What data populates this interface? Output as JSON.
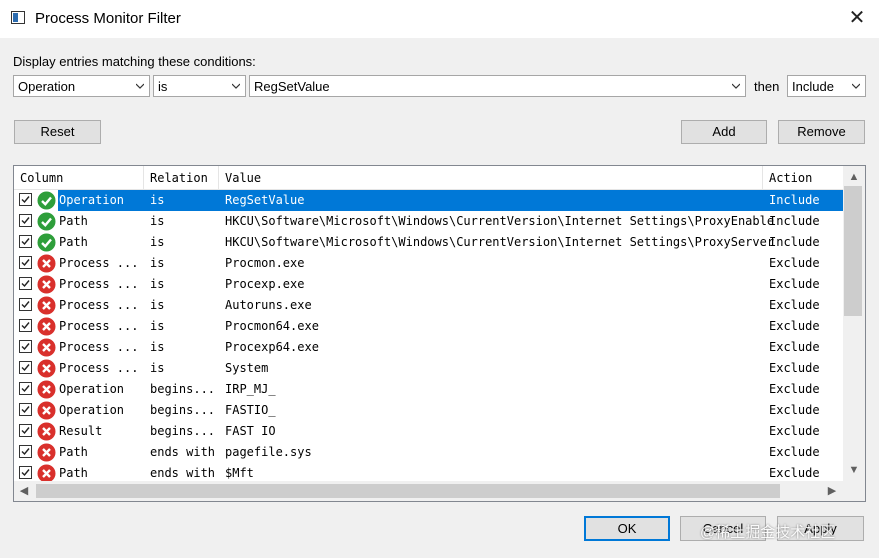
{
  "window": {
    "title": "Process Monitor Filter",
    "close_label": "✕"
  },
  "prompt": "Display entries matching these conditions:",
  "filter": {
    "column": "Operation",
    "relation": "is",
    "value": "RegSetValue",
    "then_label": "then",
    "action": "Include"
  },
  "buttons": {
    "reset": "Reset",
    "add": "Add",
    "remove": "Remove",
    "ok": "OK",
    "cancel": "Cancel",
    "apply": "Apply"
  },
  "table": {
    "headers": [
      "Column",
      "Relation",
      "Value",
      "Action"
    ],
    "rows": [
      {
        "column": "Operation",
        "relation": "is",
        "value": "RegSetValue",
        "action": "Include",
        "status": "include",
        "selected": true
      },
      {
        "column": "Path",
        "relation": "is",
        "value": "HKCU\\Software\\Microsoft\\Windows\\CurrentVersion\\Internet Settings\\ProxyEnable",
        "action": "Include",
        "status": "include"
      },
      {
        "column": "Path",
        "relation": "is",
        "value": "HKCU\\Software\\Microsoft\\Windows\\CurrentVersion\\Internet Settings\\ProxyServer",
        "action": "Include",
        "status": "include"
      },
      {
        "column": "Process ...",
        "relation": "is",
        "value": "Procmon.exe",
        "action": "Exclude",
        "status": "exclude"
      },
      {
        "column": "Process ...",
        "relation": "is",
        "value": "Procexp.exe",
        "action": "Exclude",
        "status": "exclude"
      },
      {
        "column": "Process ...",
        "relation": "is",
        "value": "Autoruns.exe",
        "action": "Exclude",
        "status": "exclude"
      },
      {
        "column": "Process ...",
        "relation": "is",
        "value": "Procmon64.exe",
        "action": "Exclude",
        "status": "exclude"
      },
      {
        "column": "Process ...",
        "relation": "is",
        "value": "Procexp64.exe",
        "action": "Exclude",
        "status": "exclude"
      },
      {
        "column": "Process ...",
        "relation": "is",
        "value": "System",
        "action": "Exclude",
        "status": "exclude"
      },
      {
        "column": "Operation",
        "relation": "begins...",
        "value": "IRP_MJ_",
        "action": "Exclude",
        "status": "exclude"
      },
      {
        "column": "Operation",
        "relation": "begins...",
        "value": "FASTIO_",
        "action": "Exclude",
        "status": "exclude"
      },
      {
        "column": "Result",
        "relation": "begins...",
        "value": "FAST IO",
        "action": "Exclude",
        "status": "exclude"
      },
      {
        "column": "Path",
        "relation": "ends with",
        "value": "pagefile.sys",
        "action": "Exclude",
        "status": "exclude"
      },
      {
        "column": "Path",
        "relation": "ends with",
        "value": "$Mft",
        "action": "Exclude",
        "status": "exclude"
      }
    ]
  },
  "watermark": "@稀土掘金技术社区",
  "colors": {
    "selection": "#0078d7",
    "include_icon": "#2e9e3a",
    "exclude_icon": "#d9302c"
  }
}
